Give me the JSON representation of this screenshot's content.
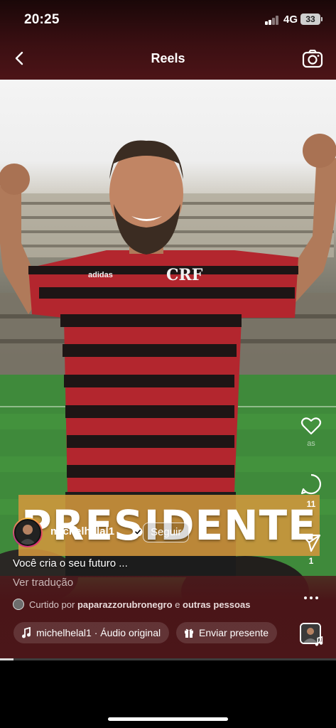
{
  "status_bar": {
    "time": "20:25",
    "network": "4G",
    "battery": "33"
  },
  "nav": {
    "title": "Reels",
    "back_icon": "chevron-left-icon",
    "camera_icon": "camera-icon"
  },
  "reel": {
    "banner_text": "PRESIDENTE",
    "likes_count": "as",
    "comments_count": "11",
    "shares_count": "1"
  },
  "author": {
    "username": "michelhelal1",
    "verified": true,
    "follow_label": "Seguir",
    "caption": "Você cria o seu futuro ..."
  },
  "translate_label": "Ver tradução",
  "liked_by": {
    "prefix": "Curtido por",
    "user": "paparazzorubronegro",
    "connector": "e",
    "others": "outras pessoas"
  },
  "audio": {
    "label": "michelhelal1 · Áudio original"
  },
  "gift": {
    "label": "Enviar presente"
  },
  "progress": 0.04,
  "colors": {
    "accent_bg": "#4b1619",
    "banner": "#d2963c"
  }
}
